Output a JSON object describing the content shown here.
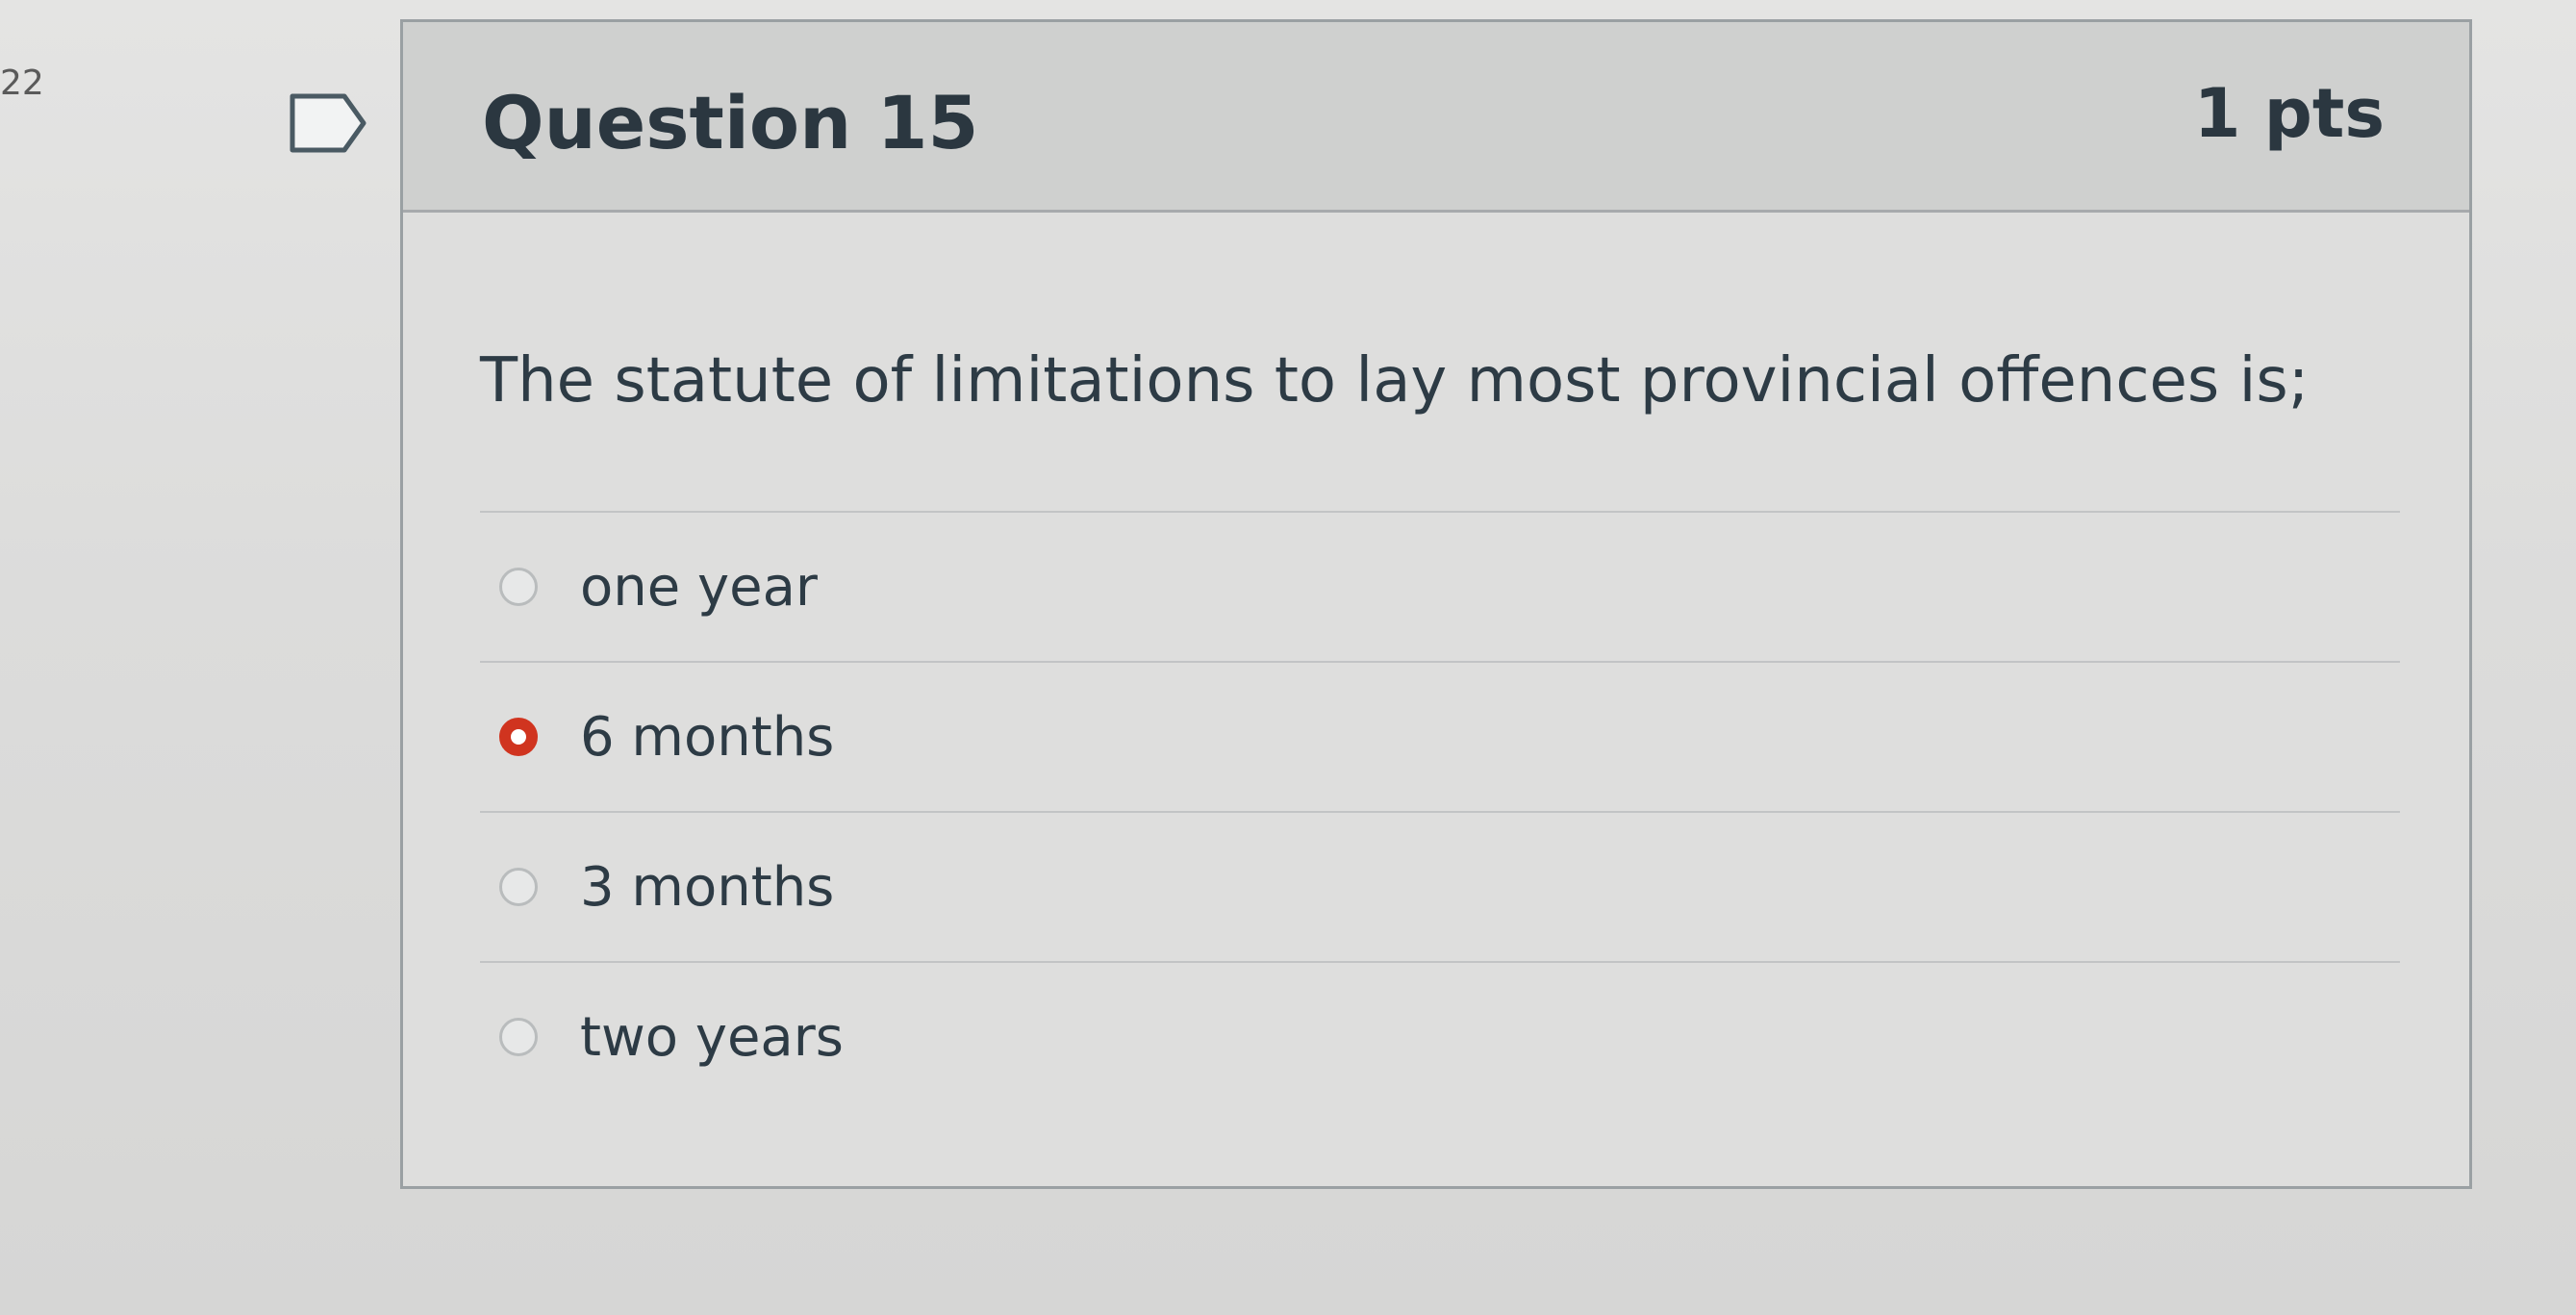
{
  "page": {
    "side_number": "22"
  },
  "question": {
    "title": "Question 15",
    "points": "1 pts",
    "text": "The statute of limitations to lay most provincial offences is;",
    "flag_icon": "bookmark-flag-icon",
    "answers": [
      {
        "label": "one year",
        "selected": false
      },
      {
        "label": "6 months",
        "selected": true
      },
      {
        "label": "3 months",
        "selected": false
      },
      {
        "label": "two years",
        "selected": false
      }
    ]
  },
  "colors": {
    "selected_radio": "#d0341f",
    "text": "#2d3b45",
    "header_bg": "#cfd0cf"
  }
}
